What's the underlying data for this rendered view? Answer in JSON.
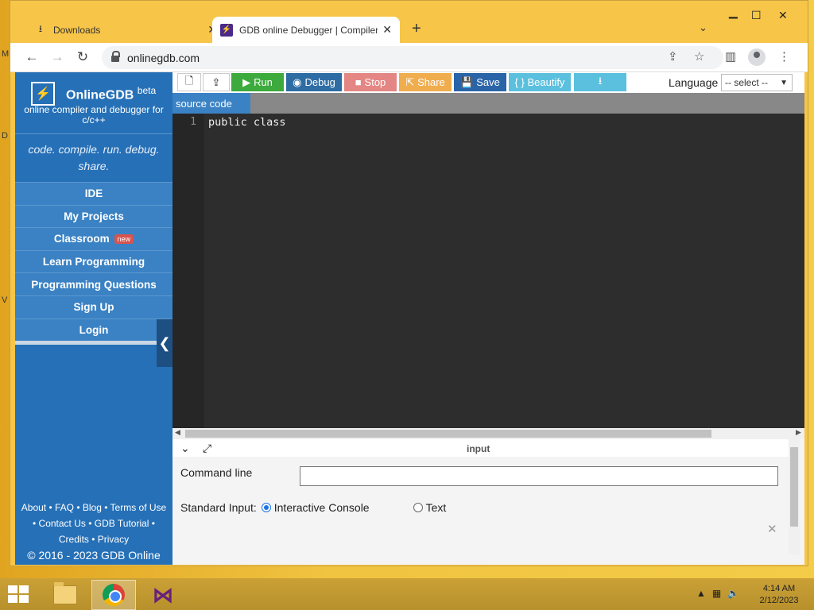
{
  "browser": {
    "tabs": [
      {
        "label": "Downloads",
        "icon": "download-icon"
      },
      {
        "label": "GDB online Debugger | Compiler",
        "icon": "gdb-favicon-icon"
      }
    ],
    "url": "onlinegdb.com"
  },
  "sidebar": {
    "brand": "OnlineGDB",
    "brand_sup": "beta",
    "subtitle": "online compiler and debugger for c/c++",
    "tagline": "code. compile. run. debug. share.",
    "items": [
      {
        "label": "IDE"
      },
      {
        "label": "My Projects"
      },
      {
        "label": "Classroom",
        "badge": "new"
      },
      {
        "label": "Learn Programming"
      },
      {
        "label": "Programming Questions"
      },
      {
        "label": "Sign Up"
      },
      {
        "label": "Login"
      }
    ],
    "footer": {
      "line1": "About • FAQ • Blog • Terms of Use",
      "line2": "• Contact Us • GDB Tutorial •",
      "line3": "Credits • Privacy",
      "copyright": "© 2016 - 2023 GDB Online"
    }
  },
  "toolbar": {
    "run": "Run",
    "debug": "Debug",
    "stop": "Stop",
    "share": "Share",
    "save": "Save",
    "beautify": "{ } Beautify",
    "language_label": "Language",
    "language_value": "-- select --"
  },
  "editor": {
    "tab": "source code",
    "lines": [
      {
        "number": "1",
        "text": "public class"
      }
    ]
  },
  "io": {
    "title": "input",
    "cmd_label": "Command line",
    "cmd_value": "",
    "stdin_label": "Standard Input:",
    "option1": "Interactive Console",
    "option2": "Text",
    "selected": "Interactive Console"
  },
  "taskbar": {
    "time": "4:14 AM",
    "date": "2/12/2023"
  },
  "colors": {
    "run": "#3caa3c",
    "debug": "#2e6da4",
    "stop": "#d9534f",
    "share": "#f0ad4e",
    "save": "#2a64a8",
    "beautify": "#5bc0de",
    "download": "#5bc0de",
    "sidebar": "#2670b7"
  }
}
